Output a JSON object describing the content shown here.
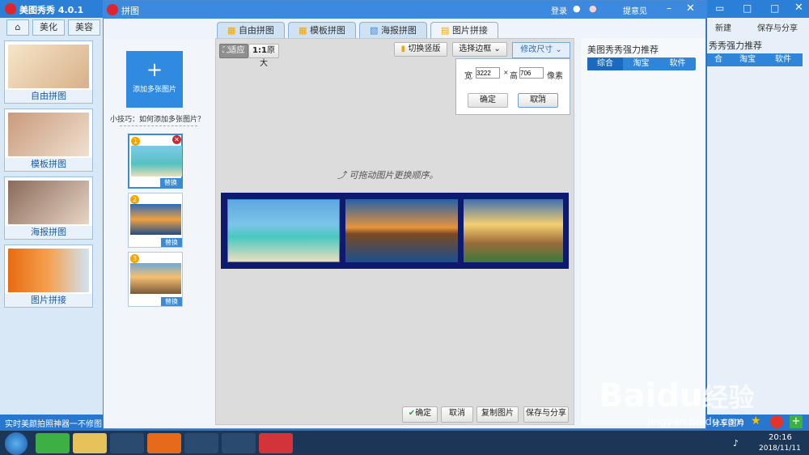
{
  "main_app": {
    "title": "美图秀秀 4.0.1",
    "tabs": [
      "美化",
      "美容"
    ],
    "status_text": "实时美颜拍照神器一不修图",
    "thumbs": [
      "自由拼图",
      "模板拼图",
      "海报拼图",
      "图片拼接"
    ],
    "right_title": "秀秀强力推荐",
    "right_tabs": [
      "合",
      "淘宝",
      "软件"
    ],
    "new_label": "新建",
    "save_share": "保存与分享",
    "share_pic": "分享图片"
  },
  "dialog": {
    "title": "拼图",
    "login": "登录",
    "feedback": "提意见",
    "tabs": [
      {
        "label": "自由拼图"
      },
      {
        "label": "模板拼图"
      },
      {
        "label": "海报拼图"
      },
      {
        "label": "图片拼接"
      }
    ],
    "add_images": "添加多张图片",
    "tip": "小技巧：如何添加多张图片？",
    "replace": "替换",
    "slots": [
      "1",
      "2",
      "3"
    ],
    "zoom_fit": "适应",
    "zoom_orig_label": "1:1",
    "zoom_orig": "原大",
    "toggle_orient": "切换竖版",
    "choose_border": "选择边框",
    "resize": "修改尺寸",
    "width_label": "宽",
    "width_value": "3222",
    "x_sep": "×",
    "height_label": "高",
    "height_value": "706",
    "pixel_label": "像素",
    "ok": "确定",
    "cancel": "取消",
    "drag_hint": "可拖动图片更换顺序。",
    "bottom": {
      "ok": "确定",
      "cancel": "取消",
      "copy": "复制图片",
      "save_share": "保存与分享"
    },
    "rec_title": "美图秀秀强力推荐",
    "rec_tabs": [
      "综合",
      "淘宝",
      "软件"
    ]
  },
  "taskbar": {
    "time": "20:16",
    "date": "2018/11/11"
  },
  "watermark": {
    "brand": "Bai",
    "brand2": "du",
    "brand3": "经验",
    "url": "jingyan.baidu.com"
  },
  "colors": {
    "accent": "#3b8ae0",
    "collage_border": "#0d1a6e"
  }
}
